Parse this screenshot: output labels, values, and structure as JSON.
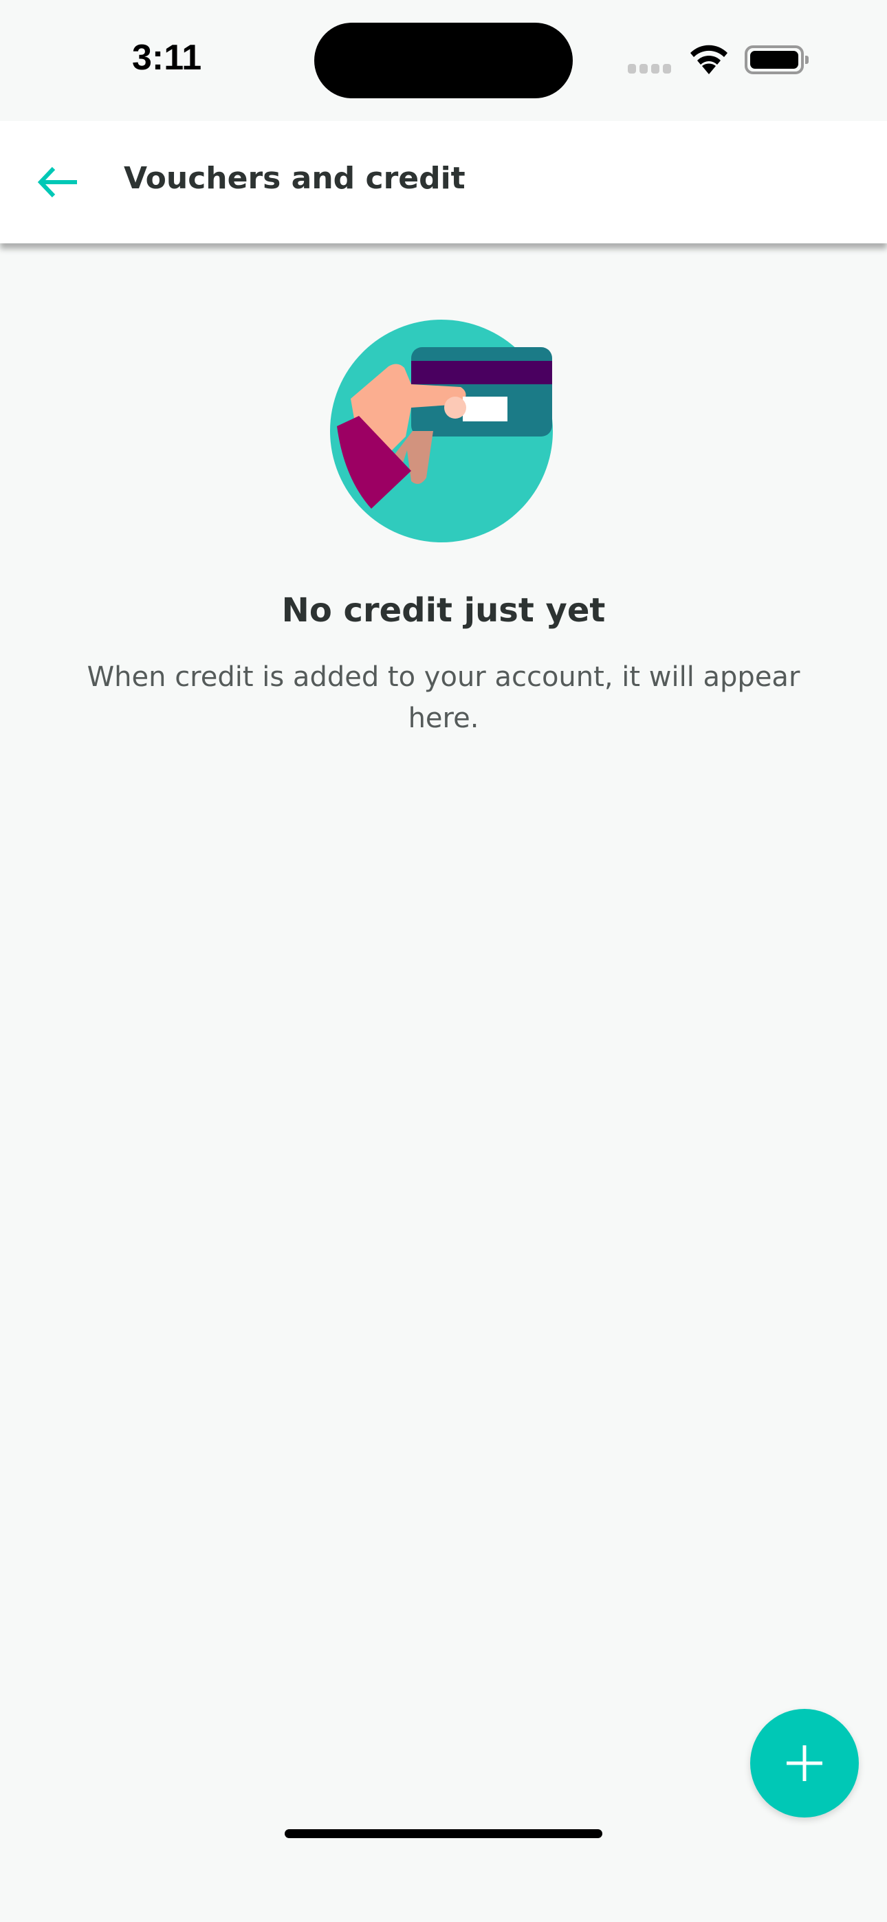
{
  "status_bar": {
    "time": "3:11"
  },
  "header": {
    "title": "Vouchers and credit",
    "back_icon": "arrow-left-icon"
  },
  "empty_state": {
    "illustration": "hand-holding-card-illustration",
    "heading": "No credit just yet",
    "message": "When credit is added to your account, it will appear here."
  },
  "fab": {
    "icon": "plus-icon"
  },
  "colors": {
    "accent": "#00c8b6",
    "text": "#2d3332",
    "background": "#f7f9f8"
  }
}
